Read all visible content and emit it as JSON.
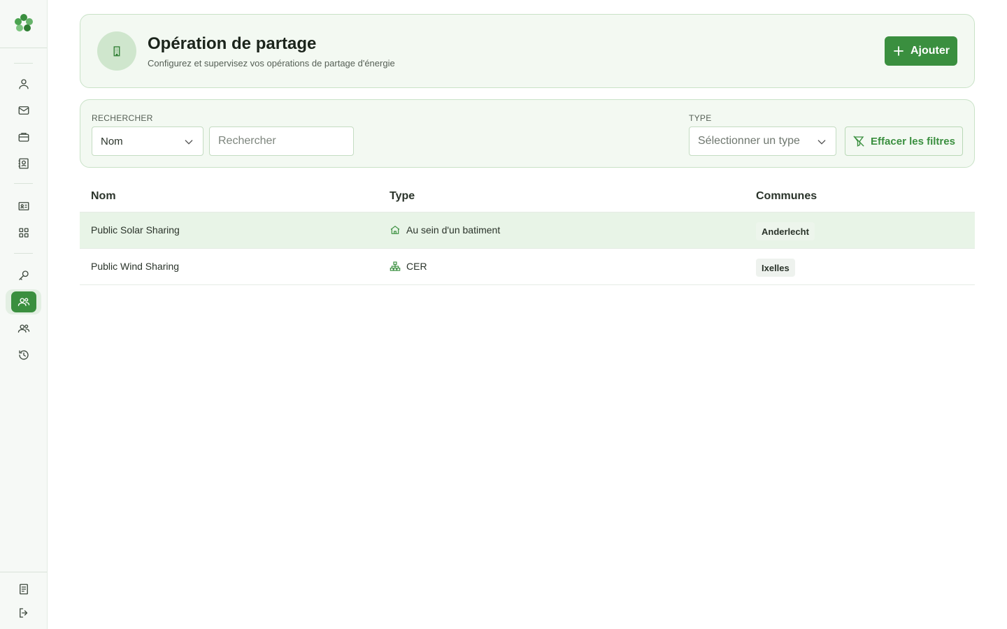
{
  "sidebar": {
    "items": [
      {
        "icon": "user-icon"
      },
      {
        "icon": "mail-icon"
      },
      {
        "icon": "briefcase-icon"
      },
      {
        "icon": "contact-book-icon"
      },
      {
        "icon": "id-card-icon"
      },
      {
        "icon": "grid-icon"
      },
      {
        "icon": "key-icon"
      },
      {
        "icon": "sharing-users-icon",
        "active": true
      },
      {
        "icon": "users-icon"
      },
      {
        "icon": "history-icon"
      }
    ],
    "bottom": [
      {
        "icon": "document-icon"
      },
      {
        "icon": "logout-icon"
      }
    ]
  },
  "header": {
    "title": "Opération de partage",
    "subtitle": "Configurez et supervisez vos opérations de partage d'énergie",
    "add_label": "Ajouter"
  },
  "filters": {
    "search_label": "RECHERCHER",
    "search_field_value": "Nom",
    "search_placeholder": "Rechercher",
    "type_label": "TYPE",
    "type_placeholder": "Sélectionner un type",
    "clear_label": "Effacer les filtres"
  },
  "table": {
    "headers": [
      "Nom",
      "Type",
      "Communes"
    ],
    "rows": [
      {
        "name": "Public Solar Sharing",
        "type": "Au sein d'un batiment",
        "type_icon": "building-icon",
        "commune": "Anderlecht"
      },
      {
        "name": "Public Wind Sharing",
        "type": "CER",
        "type_icon": "network-icon",
        "commune": "Ixelles"
      }
    ]
  },
  "colors": {
    "accent": "#3a8f3f",
    "card_bg": "#f3f9f2",
    "card_border": "#c9e2c7",
    "row_highlight": "#e8f4e7"
  }
}
